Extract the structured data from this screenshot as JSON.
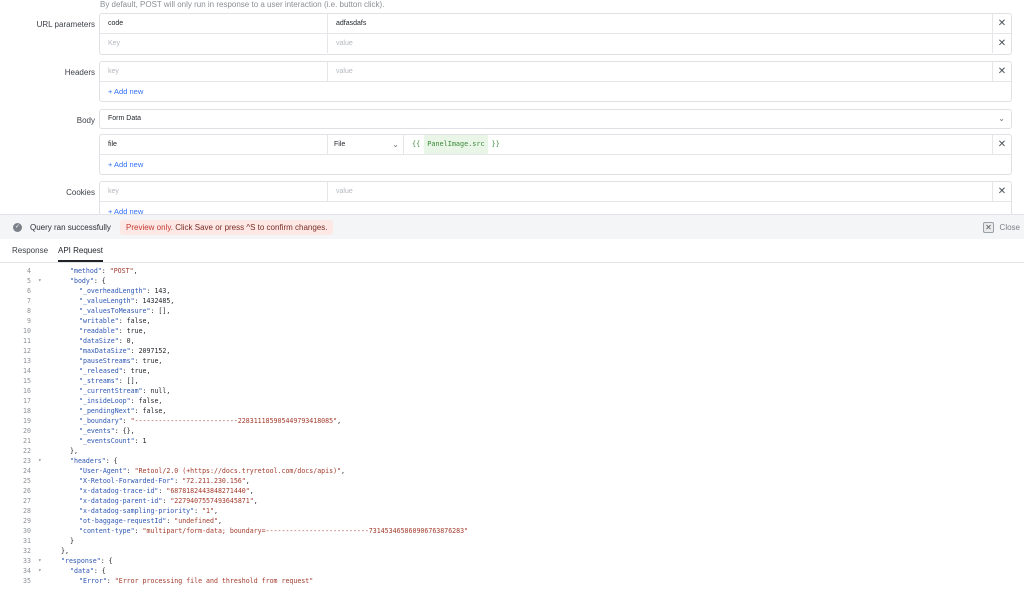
{
  "hint": "By default, POST will only run in response to a user interaction (i.e. button click).",
  "url_params": {
    "label": "URL parameters",
    "rows": [
      {
        "key": "code",
        "value": "adfasdafs"
      }
    ],
    "key_placeholder": "Key",
    "value_placeholder": "value"
  },
  "headers": {
    "label": "Headers",
    "key_placeholder": "key",
    "value_placeholder": "value",
    "add_new": "+ Add new"
  },
  "body": {
    "label": "Body",
    "type": "Form Data",
    "field_key": "file",
    "field_type": "File",
    "expr_open": "{{",
    "expr_obj": "PanelImage.src",
    "expr_close": "}}",
    "add_new": "+ Add new"
  },
  "cookies": {
    "label": "Cookies",
    "key_placeholder": "key",
    "value_placeholder": "value",
    "add_new": "+ Add new"
  },
  "status": {
    "message": "Query ran successfully",
    "preview_prefix": "Preview only.",
    "preview_text": "Click Save or press ^S to confirm changes.",
    "close": "Close"
  },
  "tabs": [
    {
      "label": "Response",
      "active": false
    },
    {
      "label": "API Request",
      "active": true
    }
  ],
  "code_lines": [
    {
      "n": "4",
      "fold": false,
      "indent": 2,
      "parts": [
        [
          "k",
          "\"method\""
        ],
        [
          "p",
          ": "
        ],
        [
          "s",
          "\"POST\""
        ],
        [
          "p",
          ","
        ]
      ]
    },
    {
      "n": "5",
      "fold": true,
      "indent": 2,
      "parts": [
        [
          "k",
          "\"body\""
        ],
        [
          "p",
          ": {"
        ]
      ]
    },
    {
      "n": "6",
      "fold": false,
      "indent": 3,
      "parts": [
        [
          "k",
          "\"_overheadLength\""
        ],
        [
          "p",
          ": "
        ],
        [
          "n",
          "143"
        ],
        [
          "p",
          ","
        ]
      ]
    },
    {
      "n": "7",
      "fold": false,
      "indent": 3,
      "parts": [
        [
          "k",
          "\"_valueLength\""
        ],
        [
          "p",
          ": "
        ],
        [
          "n",
          "1432485"
        ],
        [
          "p",
          ","
        ]
      ]
    },
    {
      "n": "8",
      "fold": false,
      "indent": 3,
      "parts": [
        [
          "k",
          "\"_valuesToMeasure\""
        ],
        [
          "p",
          ": [],"
        ]
      ]
    },
    {
      "n": "9",
      "fold": false,
      "indent": 3,
      "parts": [
        [
          "k",
          "\"writable\""
        ],
        [
          "p",
          ": "
        ],
        [
          "n",
          "false"
        ],
        [
          "p",
          ","
        ]
      ]
    },
    {
      "n": "10",
      "fold": false,
      "indent": 3,
      "parts": [
        [
          "k",
          "\"readable\""
        ],
        [
          "p",
          ": "
        ],
        [
          "n",
          "true"
        ],
        [
          "p",
          ","
        ]
      ]
    },
    {
      "n": "11",
      "fold": false,
      "indent": 3,
      "parts": [
        [
          "k",
          "\"dataSize\""
        ],
        [
          "p",
          ": "
        ],
        [
          "n",
          "0"
        ],
        [
          "p",
          ","
        ]
      ]
    },
    {
      "n": "12",
      "fold": false,
      "indent": 3,
      "parts": [
        [
          "k",
          "\"maxDataSize\""
        ],
        [
          "p",
          ": "
        ],
        [
          "n",
          "2097152"
        ],
        [
          "p",
          ","
        ]
      ]
    },
    {
      "n": "13",
      "fold": false,
      "indent": 3,
      "parts": [
        [
          "k",
          "\"pauseStreams\""
        ],
        [
          "p",
          ": "
        ],
        [
          "n",
          "true"
        ],
        [
          "p",
          ","
        ]
      ]
    },
    {
      "n": "14",
      "fold": false,
      "indent": 3,
      "parts": [
        [
          "k",
          "\"_released\""
        ],
        [
          "p",
          ": "
        ],
        [
          "n",
          "true"
        ],
        [
          "p",
          ","
        ]
      ]
    },
    {
      "n": "15",
      "fold": false,
      "indent": 3,
      "parts": [
        [
          "k",
          "\"_streams\""
        ],
        [
          "p",
          ": [],"
        ]
      ]
    },
    {
      "n": "16",
      "fold": false,
      "indent": 3,
      "parts": [
        [
          "k",
          "\"_currentStream\""
        ],
        [
          "p",
          ": "
        ],
        [
          "n",
          "null"
        ],
        [
          "p",
          ","
        ]
      ]
    },
    {
      "n": "17",
      "fold": false,
      "indent": 3,
      "parts": [
        [
          "k",
          "\"_insideLoop\""
        ],
        [
          "p",
          ": "
        ],
        [
          "n",
          "false"
        ],
        [
          "p",
          ","
        ]
      ]
    },
    {
      "n": "18",
      "fold": false,
      "indent": 3,
      "parts": [
        [
          "k",
          "\"_pendingNext\""
        ],
        [
          "p",
          ": "
        ],
        [
          "n",
          "false"
        ],
        [
          "p",
          ","
        ]
      ]
    },
    {
      "n": "19",
      "fold": false,
      "indent": 3,
      "parts": [
        [
          "k",
          "\"_boundary\""
        ],
        [
          "p",
          ": "
        ],
        [
          "s",
          "\"--------------------------228311185905449793418085\""
        ],
        [
          "p",
          ","
        ]
      ]
    },
    {
      "n": "20",
      "fold": false,
      "indent": 3,
      "parts": [
        [
          "k",
          "\"_events\""
        ],
        [
          "p",
          ": {},"
        ]
      ]
    },
    {
      "n": "21",
      "fold": false,
      "indent": 3,
      "parts": [
        [
          "k",
          "\"_eventsCount\""
        ],
        [
          "p",
          ": "
        ],
        [
          "n",
          "1"
        ]
      ]
    },
    {
      "n": "22",
      "fold": false,
      "indent": 2,
      "parts": [
        [
          "p",
          "},"
        ]
      ]
    },
    {
      "n": "23",
      "fold": true,
      "indent": 2,
      "parts": [
        [
          "k",
          "\"headers\""
        ],
        [
          "p",
          ": {"
        ]
      ]
    },
    {
      "n": "24",
      "fold": false,
      "indent": 3,
      "parts": [
        [
          "k",
          "\"User-Agent\""
        ],
        [
          "p",
          ": "
        ],
        [
          "s",
          "\"Retool/2.0 (+https://docs.tryretool.com/docs/apis)\""
        ],
        [
          "p",
          ","
        ]
      ]
    },
    {
      "n": "25",
      "fold": false,
      "indent": 3,
      "parts": [
        [
          "k",
          "\"X-Retool-Forwarded-For\""
        ],
        [
          "p",
          ": "
        ],
        [
          "s",
          "\"72.211.230.156\""
        ],
        [
          "p",
          ","
        ]
      ]
    },
    {
      "n": "26",
      "fold": false,
      "indent": 3,
      "parts": [
        [
          "k",
          "\"x-datadog-trace-id\""
        ],
        [
          "p",
          ": "
        ],
        [
          "s",
          "\"6878182443848271440\""
        ],
        [
          "p",
          ","
        ]
      ]
    },
    {
      "n": "27",
      "fold": false,
      "indent": 3,
      "parts": [
        [
          "k",
          "\"x-datadog-parent-id\""
        ],
        [
          "p",
          ": "
        ],
        [
          "s",
          "\"2279407557493645871\""
        ],
        [
          "p",
          ","
        ]
      ]
    },
    {
      "n": "28",
      "fold": false,
      "indent": 3,
      "parts": [
        [
          "k",
          "\"x-datadog-sampling-priority\""
        ],
        [
          "p",
          ": "
        ],
        [
          "s",
          "\"1\""
        ],
        [
          "p",
          ","
        ]
      ]
    },
    {
      "n": "29",
      "fold": false,
      "indent": 3,
      "parts": [
        [
          "k",
          "\"ot-baggage-requestId\""
        ],
        [
          "p",
          ": "
        ],
        [
          "s",
          "\"undefined\""
        ],
        [
          "p",
          ","
        ]
      ]
    },
    {
      "n": "30",
      "fold": false,
      "indent": 3,
      "parts": [
        [
          "k",
          "\"content-type\""
        ],
        [
          "p",
          ": "
        ],
        [
          "s",
          "\"multipart/form-data; boundary=--------------------------731453465860906763876283\""
        ]
      ]
    },
    {
      "n": "31",
      "fold": false,
      "indent": 2,
      "parts": [
        [
          "p",
          "}"
        ]
      ]
    },
    {
      "n": "32",
      "fold": false,
      "indent": 1,
      "parts": [
        [
          "p",
          "},"
        ]
      ]
    },
    {
      "n": "33",
      "fold": true,
      "indent": 1,
      "parts": [
        [
          "k",
          "\"response\""
        ],
        [
          "p",
          ": {"
        ]
      ]
    },
    {
      "n": "34",
      "fold": true,
      "indent": 2,
      "parts": [
        [
          "k",
          "\"data\""
        ],
        [
          "p",
          ": {"
        ]
      ]
    },
    {
      "n": "35",
      "fold": false,
      "indent": 3,
      "parts": [
        [
          "k",
          "\"Error\""
        ],
        [
          "p",
          ": "
        ],
        [
          "s",
          "\"Error processing file and threshold from request\""
        ]
      ]
    }
  ]
}
